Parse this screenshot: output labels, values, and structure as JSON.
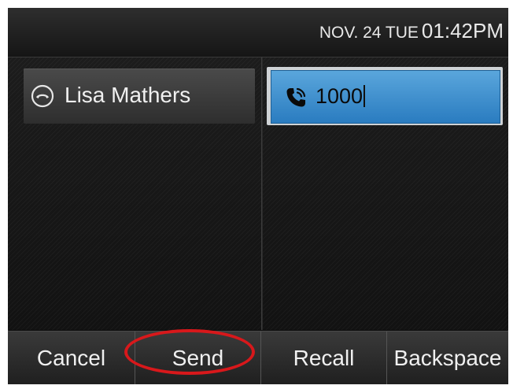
{
  "status_bar": {
    "date": "NOV. 24 TUE",
    "time": "01:42PM"
  },
  "line_key": {
    "label": "Lisa Mathers",
    "icon": "hang-up-icon"
  },
  "dial_input": {
    "value": "1000",
    "icon": "phone-handset-icon"
  },
  "softkeys": [
    {
      "label": "Cancel"
    },
    {
      "label": "Send"
    },
    {
      "label": "Recall"
    },
    {
      "label": "Backspace"
    }
  ],
  "colors": {
    "highlight": "#d8181b",
    "input_accent": "#3a8fd0"
  }
}
